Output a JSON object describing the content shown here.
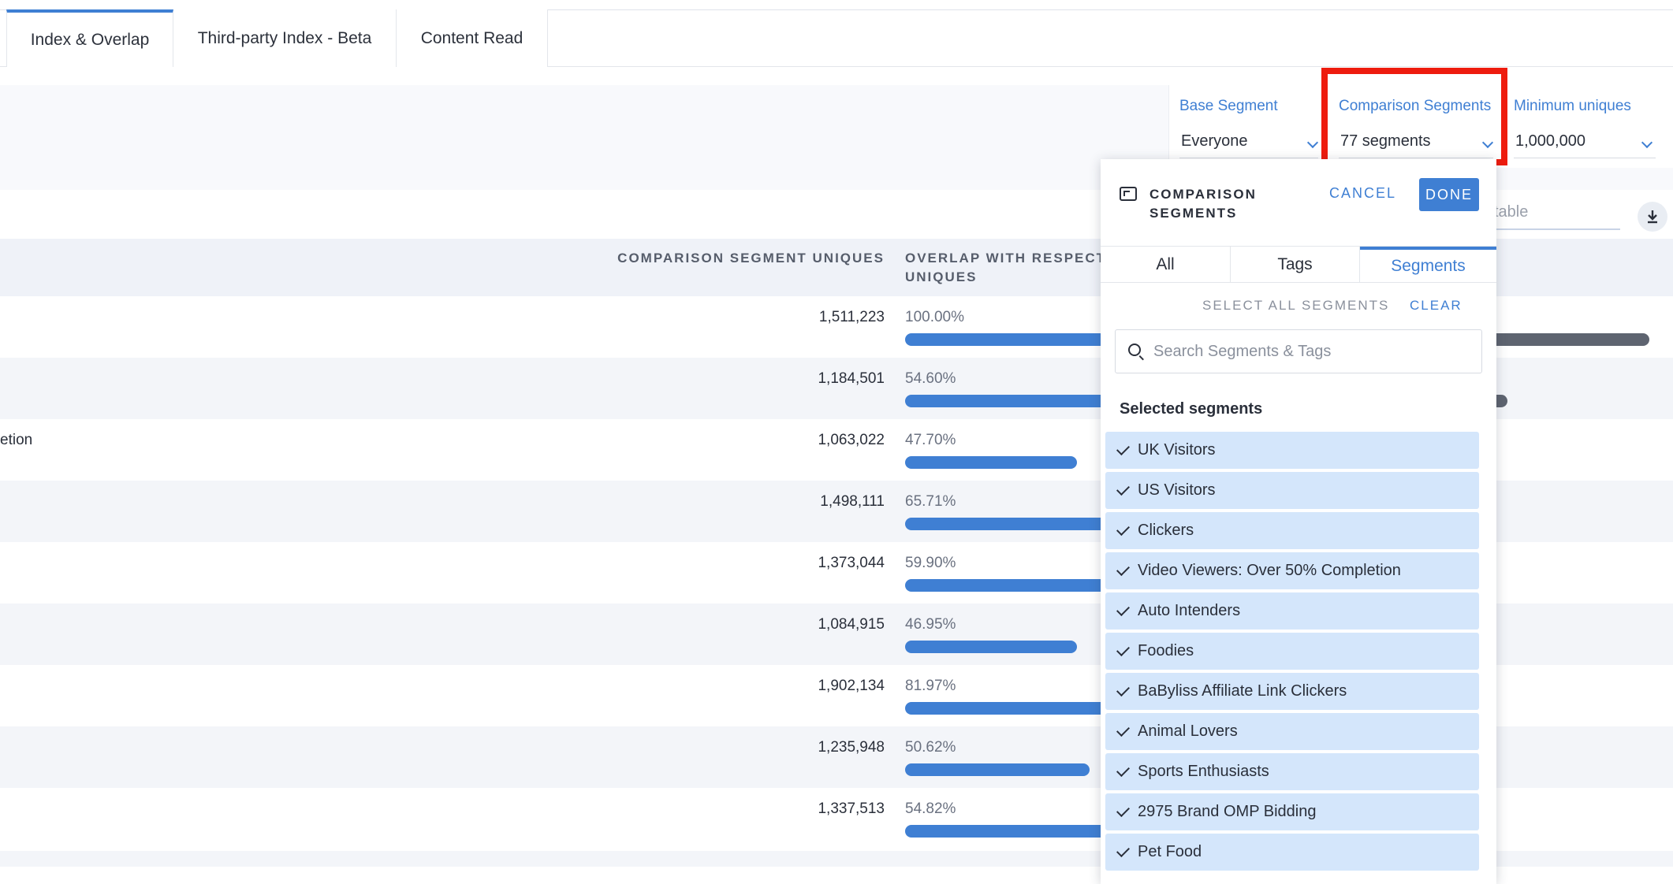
{
  "tabs": [
    {
      "label": "Index & Overlap",
      "active": true
    },
    {
      "label": "Third-party Index - Beta",
      "active": false
    },
    {
      "label": "Content Read",
      "active": false
    }
  ],
  "filters": {
    "base_segment": {
      "label": "Base Segment",
      "value": "Everyone"
    },
    "comparison_segments": {
      "label": "Comparison Segments",
      "value": "77 segments"
    },
    "minimum_uniques": {
      "label": "Minimum uniques",
      "value": "1,000,000"
    }
  },
  "table": {
    "columns": {
      "comparison_uniques": "COMPARISON SEGMENT UNIQUES",
      "overlap": "OVERLAP WITH RESPECT UNIQUES"
    },
    "rows": [
      {
        "name": "",
        "uniques": "1,511,223",
        "overlap": "100.00%",
        "overlap_value": 100.0
      },
      {
        "name": "",
        "uniques": "1,184,501",
        "overlap": "54.60%",
        "overlap_value": 54.6
      },
      {
        "name": "etion",
        "uniques": "1,063,022",
        "overlap": "47.70%",
        "overlap_value": 47.7
      },
      {
        "name": "",
        "uniques": "1,498,111",
        "overlap": "65.71%",
        "overlap_value": 65.71
      },
      {
        "name": "",
        "uniques": "1,373,044",
        "overlap": "59.90%",
        "overlap_value": 59.9
      },
      {
        "name": "",
        "uniques": "1,084,915",
        "overlap": "46.95%",
        "overlap_value": 46.95
      },
      {
        "name": "",
        "uniques": "1,902,134",
        "overlap": "81.97%",
        "overlap_value": 81.97
      },
      {
        "name": "",
        "uniques": "1,235,948",
        "overlap": "50.62%",
        "overlap_value": 50.62
      },
      {
        "name": "",
        "uniques": "1,337,513",
        "overlap": "54.82%",
        "overlap_value": 54.82
      }
    ],
    "search_tail": "table"
  },
  "popover": {
    "title": "COMPARISON SEGMENTS",
    "cancel_label": "CANCEL",
    "done_label": "DONE",
    "tabs": [
      {
        "label": "All",
        "active": false
      },
      {
        "label": "Tags",
        "active": false
      },
      {
        "label": "Segments",
        "active": true
      }
    ],
    "select_all_label": "SELECT ALL SEGMENTS",
    "clear_label": "CLEAR",
    "search_placeholder": "Search Segments & Tags",
    "selected_heading": "Selected segments",
    "selected_segments": [
      "UK Visitors",
      "US Visitors",
      "Clickers",
      "Video Viewers: Over 50% Completion",
      "Auto Intenders",
      "Foodies",
      "BaByliss Affiliate Link Clickers",
      "Animal Lovers",
      "Sports Enthusiasts",
      "2975 Brand OMP Bidding",
      "Pet Food"
    ]
  },
  "colors": {
    "accent": "#3f7fd3",
    "highlight": "#ee1c0e",
    "selected_bg": "#d4e6fb",
    "dark_bar": "#5e6470"
  },
  "icons": [
    "segments-icon",
    "search-icon",
    "download-icon",
    "check-icon",
    "chevron-down-icon"
  ]
}
